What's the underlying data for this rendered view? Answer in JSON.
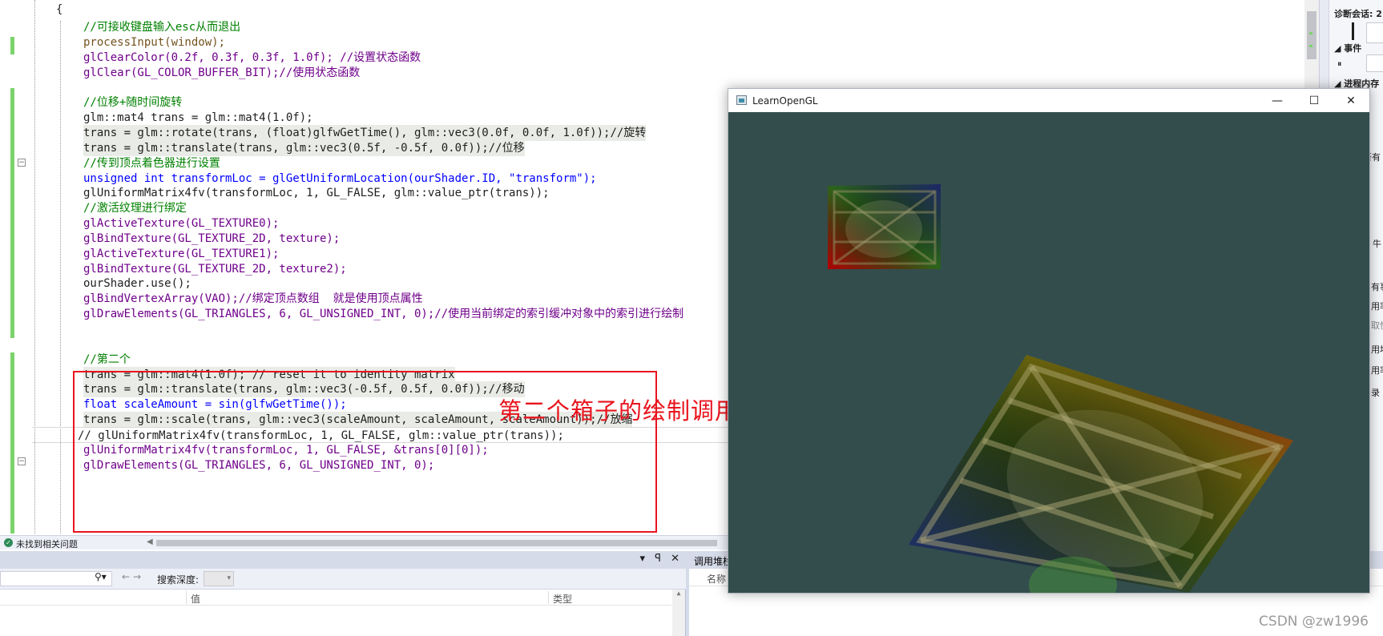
{
  "editor": {
    "brace": "{",
    "lines": [
      {
        "text": "//可接收键盘输入esc从而退出",
        "cls": "c"
      },
      {
        "text": "processInput(window);",
        "cls": "f"
      },
      {
        "text": "glClearColor(0.2f, 0.3f, 0.3f, 1.0f); //设置状态函数",
        "cls": "m"
      },
      {
        "text": "glClear(GL_COLOR_BUFFER_BIT);//使用状态函数",
        "cls": "m"
      },
      {
        "text": "",
        "cls": ""
      },
      {
        "text": "//位移+随时间旋转",
        "cls": "c"
      },
      {
        "text": "glm::mat4 trans = glm::mat4(1.0f);",
        "cls": ""
      },
      {
        "text": "trans = glm::rotate(trans, (float)glfwGetTime(), glm::vec3(0.0f, 0.0f, 1.0f));//旋转",
        "cls": "h"
      },
      {
        "text": "trans = glm::translate(trans, glm::vec3(0.5f, -0.5f, 0.0f));//位移",
        "cls": "h"
      },
      {
        "text": "//传到顶点着色器进行设置",
        "cls": "c"
      },
      {
        "text": "unsigned int transformLoc = glGetUniformLocation(ourShader.ID, \"transform\");",
        "cls": "k"
      },
      {
        "text": "glUniformMatrix4fv(transformLoc, 1, GL_FALSE, glm::value_ptr(trans));",
        "cls": ""
      },
      {
        "text": "//激活纹理进行绑定",
        "cls": "c"
      },
      {
        "text": "glActiveTexture(GL_TEXTURE0);",
        "cls": "m"
      },
      {
        "text": "glBindTexture(GL_TEXTURE_2D, texture);",
        "cls": "m"
      },
      {
        "text": "glActiveTexture(GL_TEXTURE1);",
        "cls": "m"
      },
      {
        "text": "glBindTexture(GL_TEXTURE_2D, texture2);",
        "cls": "m"
      },
      {
        "text": "ourShader.use();",
        "cls": ""
      },
      {
        "text": "glBindVertexArray(VAO);//绑定顶点数组  就是使用顶点属性",
        "cls": "m"
      },
      {
        "text": "glDrawElements(GL_TRIANGLES, 6, GL_UNSIGNED_INT, 0);//使用当前绑定的索引缓冲对象中的索引进行绘制",
        "cls": "m"
      },
      {
        "text": "",
        "cls": ""
      },
      {
        "text": "",
        "cls": ""
      },
      {
        "text": "//第二个",
        "cls": "c"
      },
      {
        "text": "trans = glm::mat4(1.0f); // reset it to identity matrix",
        "cls": "h"
      },
      {
        "text": "trans = glm::translate(trans, glm::vec3(-0.5f, 0.5f, 0.0f));//移动",
        "cls": "h"
      },
      {
        "text": "float scaleAmount = sin(glfwGetTime());",
        "cls": "k"
      },
      {
        "text": "trans = glm::scale(trans, glm::vec3(scaleAmount, scaleAmount, scaleAmount));//放缩",
        "cls": "h"
      },
      {
        "text": "// glUniformMatrix4fv(transformLoc, 1, GL_FALSE, glm::value_ptr(trans));",
        "cls": "cur"
      },
      {
        "text": "glUniformMatrix4fv(transformLoc, 1, GL_FALSE, &trans[0][0]);",
        "cls": "m"
      },
      {
        "text": "glDrawElements(GL_TRIANGLES, 6, GL_UNSIGNED_INT, 0);",
        "cls": "m"
      }
    ],
    "annotation": "第二个箱子的绘制调用"
  },
  "status_bar": {
    "message": "未找到相关问题"
  },
  "locals_panel": {
    "title_icons": [
      "▾",
      "ꟼ",
      "✕"
    ],
    "search_depth_label": "搜索深度:",
    "col_value": "值",
    "col_type": "类型"
  },
  "callstack_panel": {
    "title": "调用堆栈",
    "col_name": "名称"
  },
  "diagnostics": {
    "session_label": "诊断会话: 2",
    "events_label": "◢ 事件",
    "pause_icon": "⏸",
    "process_memory_label": "◢ 进程内存 (",
    "frag1": "所有",
    "frag2": "牛",
    "frag3": "有事",
    "frag4": "用率",
    "frag5": "取快",
    "frag6": "用堆",
    "frag7": "用率",
    "frag8": "录 C"
  },
  "gl_window": {
    "title": "LearnOpenGL",
    "minimize": "—",
    "maximize": "☐",
    "close": "✕",
    "clear_color": "#334d4d"
  },
  "watermark": "CSDN @zw1996"
}
